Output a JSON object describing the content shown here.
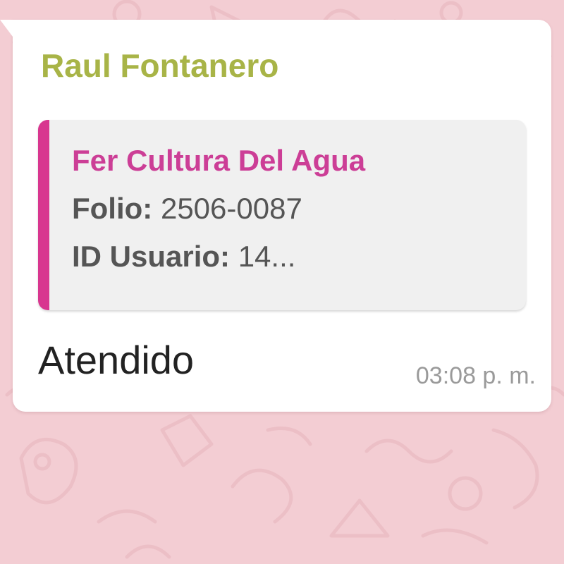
{
  "colors": {
    "wallpaper": "#f3cdd3",
    "bubble": "#ffffff",
    "sender_name": "#a8b447",
    "quote_accent": "#d8368f",
    "quote_author": "#cc3e96",
    "quote_background": "#f0f0f0",
    "timestamp": "#9a9a9a"
  },
  "message": {
    "sender": "Raul Fontanero",
    "quoted": {
      "author": "Fer Cultura Del Agua",
      "line1_key": "Folio:",
      "line1_value": "2506-0087",
      "line2_key": "ID Usuario:",
      "line2_value": "14..."
    },
    "text": "Atendido",
    "time": "03:08 p. m."
  }
}
